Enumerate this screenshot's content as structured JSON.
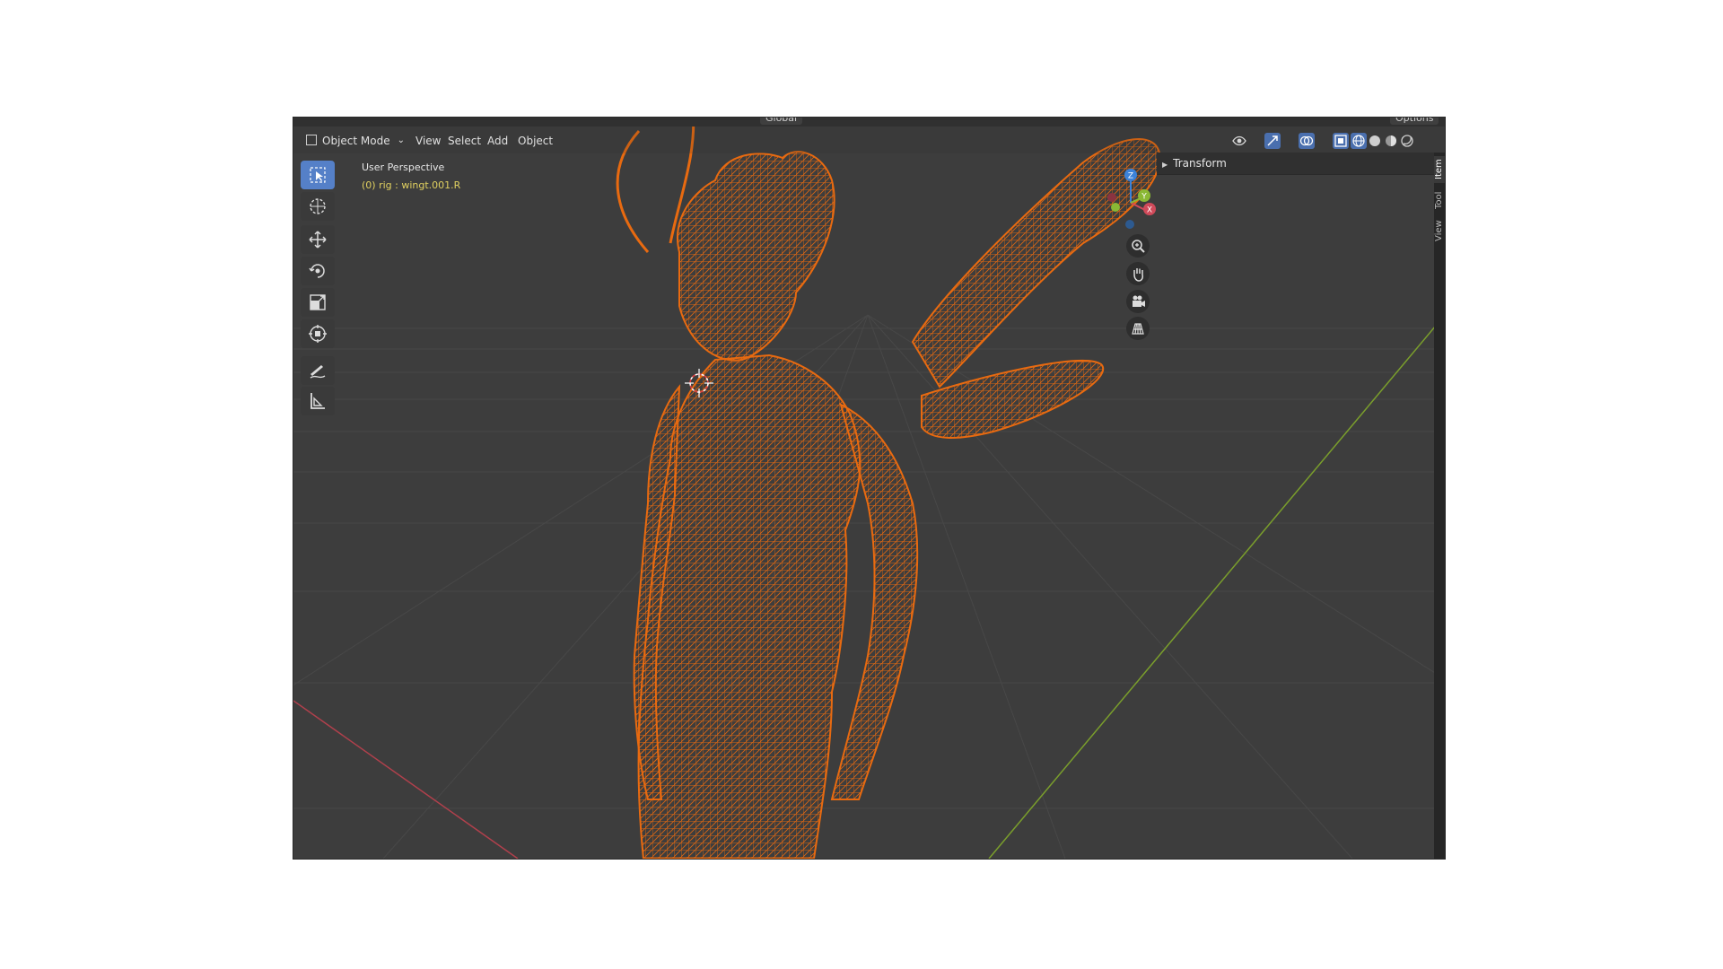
{
  "tool_header": {
    "orientation": "Global",
    "options_label": "Options"
  },
  "viewport_header": {
    "mode": "Object Mode",
    "menus": [
      "View",
      "Select",
      "Add",
      "Object"
    ]
  },
  "overlay": {
    "view_name": "User Perspective",
    "object_info": "(0) rig : wingt.001.R"
  },
  "gizmo": {
    "axes": [
      "X",
      "Y",
      "Z"
    ]
  },
  "sidebar": {
    "panel_title": "Transform",
    "tabs": [
      "Item",
      "Tool",
      "View"
    ]
  },
  "colors": {
    "viewport_bg": "#3d3d3d",
    "wireframe": "#e86a10",
    "active_tool": "#5580c8",
    "x_axis": "#d04a5a",
    "y_axis": "#8ab835",
    "z_axis": "#3c82d8"
  },
  "icons": {
    "tools": [
      "select-box-icon",
      "cursor-icon",
      "move-icon",
      "rotate-icon",
      "scale-icon",
      "transform-icon",
      "annotate-icon",
      "measure-icon"
    ],
    "nav": [
      "zoom-icon",
      "pan-hand-icon",
      "camera-icon",
      "grid-icon"
    ]
  }
}
